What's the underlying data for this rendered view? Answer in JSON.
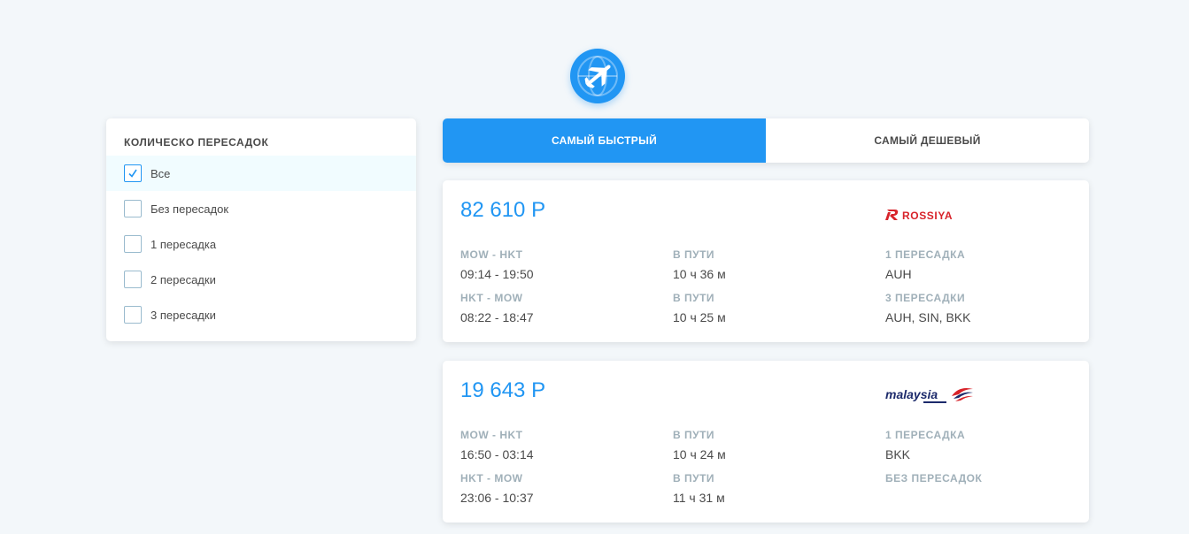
{
  "filter": {
    "title": "Колическо пересадок",
    "items": [
      {
        "label": "Все",
        "checked": true
      },
      {
        "label": "Без пересадок",
        "checked": false
      },
      {
        "label": "1 пересадка",
        "checked": false
      },
      {
        "label": "2 пересадки",
        "checked": false
      },
      {
        "label": "3 пересадки",
        "checked": false
      }
    ]
  },
  "tabs": [
    {
      "label": "САМЫЙ БЫСТРЫЙ",
      "active": true
    },
    {
      "label": "САМЫЙ ДЕШЕВЫЙ",
      "active": false
    }
  ],
  "tickets": [
    {
      "price": "82 610 Р",
      "carrier": "ROSSIYA",
      "segments": [
        {
          "route": "MOW - HKT",
          "time": "09:14 - 19:50",
          "duration_label": "В ПУТИ",
          "duration": "10 ч 36 м",
          "stops_label": "1 ПЕРЕСАДКА",
          "stops": "AUH"
        },
        {
          "route": "HKT - MOW",
          "time": "08:22 - 18:47",
          "duration_label": "В ПУТИ",
          "duration": "10 ч 25 м",
          "stops_label": "3 ПЕРЕСАДКИ",
          "stops": "AUH, SIN, BKK"
        }
      ]
    },
    {
      "price": "19 643 Р",
      "carrier": "malaysia",
      "segments": [
        {
          "route": "MOW - HKT",
          "time": "16:50 - 03:14",
          "duration_label": "В ПУТИ",
          "duration": "10 ч 24 м",
          "stops_label": "1 ПЕРЕСАДКА",
          "stops": "BKK"
        },
        {
          "route": "HKT - MOW",
          "time": "23:06 - 10:37",
          "duration_label": "В ПУТИ",
          "duration": "11 ч 31 м",
          "stops_label": "БЕЗ ПЕРЕСАДОК",
          "stops": ""
        }
      ]
    }
  ],
  "colors": {
    "accent": "#2196f3",
    "rossiya_red": "#d8232a",
    "malaysia_navy": "#1c2a6b"
  },
  "icons": {
    "logo": "airplane-globe-icon",
    "check": "checkmark-icon"
  }
}
